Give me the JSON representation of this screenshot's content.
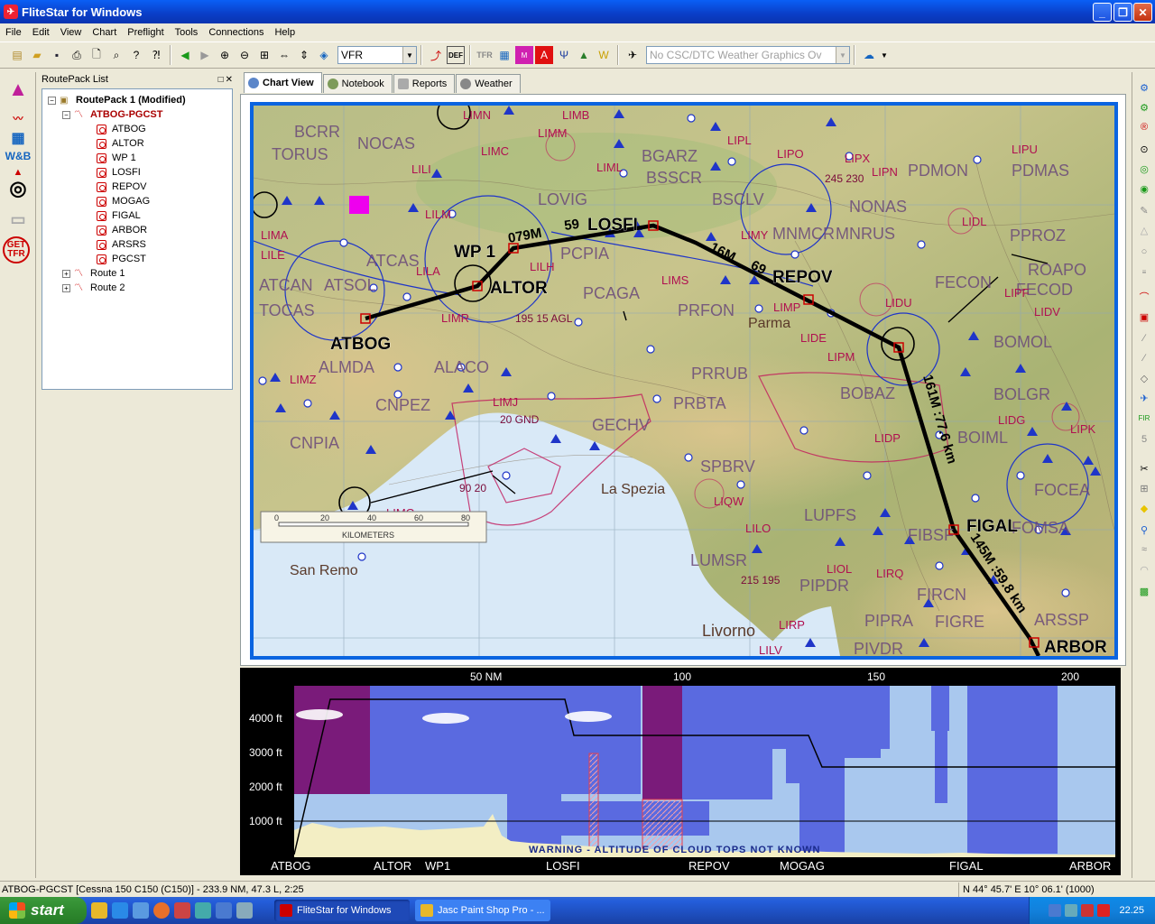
{
  "window": {
    "title": "FliteStar for Windows"
  },
  "menu": [
    "File",
    "Edit",
    "View",
    "Chart",
    "Preflight",
    "Tools",
    "Connections",
    "Help"
  ],
  "toolbar": {
    "chart_type": "VFR",
    "weather_combo": "No CSC/DTC Weather Graphics Ov",
    "tfr_label": "TFR",
    "def_label": "DEF"
  },
  "routepack": {
    "panel_title": "RoutePack List",
    "root": "RoutePack 1 (Modified)",
    "route": "ATBOG-PGCST",
    "waypoints": [
      "ATBOG",
      "ALTOR",
      "WP 1",
      "LOSFI",
      "REPOV",
      "MOGAG",
      "FIGAL",
      "ARBOR",
      "ARSRS",
      "PGCST"
    ],
    "others": [
      "Route 1",
      "Route 2"
    ]
  },
  "lefttools": {
    "wb": "W&B",
    "tfr": "GET TFR"
  },
  "tabs": [
    "Chart View",
    "Notebook",
    "Reports",
    "Weather"
  ],
  "map": {
    "route_labels": [
      "ATBOG",
      "WP 1",
      "ALTOR",
      "LOSFI",
      "REPOV",
      "FIGAL",
      "ARBOR"
    ],
    "place_labels": [
      "La Spezia",
      "San Remo",
      "Livorno",
      "Parma"
    ],
    "airspace_labels": [
      "LIMB",
      "LIMN",
      "LIMM",
      "LIMC",
      "LIML",
      "LIPL",
      "LIPO",
      "LIPX",
      "LIPN",
      "LIPU",
      "LIDL",
      "LIMA",
      "LILA",
      "LILH",
      "LIMR",
      "LIMS",
      "LIMP",
      "LIPM",
      "LIDE",
      "LIDU",
      "LIPF",
      "LIDV",
      "LIMZ",
      "LIMJ",
      "LIDP",
      "LIDG",
      "LIPK",
      "LIQW",
      "LILO",
      "LIOL",
      "LIRQ",
      "LIMG",
      "LILE",
      "LILI",
      "LILM",
      "LIMY",
      "LIRP",
      "LILV"
    ],
    "fix_labels": [
      "TORUS",
      "NOCAS",
      "BCRR",
      "LOVIG",
      "BGARZ",
      "BSSCR",
      "BSCLV",
      "NONAS",
      "PDMON",
      "PDMAS",
      "ATCAS",
      "ATCAN",
      "ATSOL",
      "TOCAS",
      "ALMDA",
      "ALACO",
      "PCPIA",
      "PCAGA",
      "PRFON",
      "PRRUB",
      "PRBTA",
      "MNMCR",
      "MNRUS",
      "FECON",
      "FECOD",
      "ROAPO",
      "BOMOL",
      "BOBAZ",
      "BOIML",
      "BOLGR",
      "CNPEZ",
      "CNPIA",
      "GECHV",
      "SPBRV",
      "LUPFS",
      "LUMSR",
      "PIPDR",
      "PIPRA",
      "FIGRE",
      "FIBSF",
      "FIRCN",
      "FOMSA",
      "ARSSP",
      "PIVDR",
      "FOCEA",
      "PPROZ"
    ],
    "leg_labels": [
      "079M",
      "59",
      "16M",
      "69",
      "161M :77.6 km",
      "145M :59.8 km"
    ],
    "alt_labels": [
      "20 GND",
      "90 20",
      "195 15 AGL",
      "215 195",
      "245 230"
    ],
    "scale": {
      "ticks": [
        "0",
        "20",
        "40",
        "60",
        "80"
      ],
      "unit": "KILOMETERS"
    }
  },
  "profile": {
    "dist_labels": [
      "50 NM",
      "100",
      "150",
      "200"
    ],
    "alt_labels": [
      "4000 ft",
      "3000 ft",
      "2000 ft",
      "1000 ft"
    ],
    "warning": "WARNING - ALTITUDE OF CLOUD TOPS NOT KNOWN",
    "wp_labels": [
      "ATBOG",
      "ALTOR",
      "WP1",
      "LOSFI",
      "REPOV",
      "MOGAG",
      "FIGAL",
      "ARBOR"
    ]
  },
  "status": {
    "left": "ATBOG-PGCST [Cessna 150 C150 (C150)] - 233.9 NM, 47.3 L, 2:25",
    "right": "N 44° 45.7' E 10° 06.1' (1000)"
  },
  "taskbar": {
    "start": "start",
    "tasks": [
      "FliteStar for Windows",
      "Jasc Paint Shop Pro - ..."
    ],
    "clock": "22.25"
  },
  "colors": {
    "titlebar": "#0a3ec7",
    "map_border": "#0a64e0",
    "profile_bg": "#000000",
    "route": "#000000",
    "airspace": "#1f35c8",
    "restricted": "#c2185b"
  }
}
